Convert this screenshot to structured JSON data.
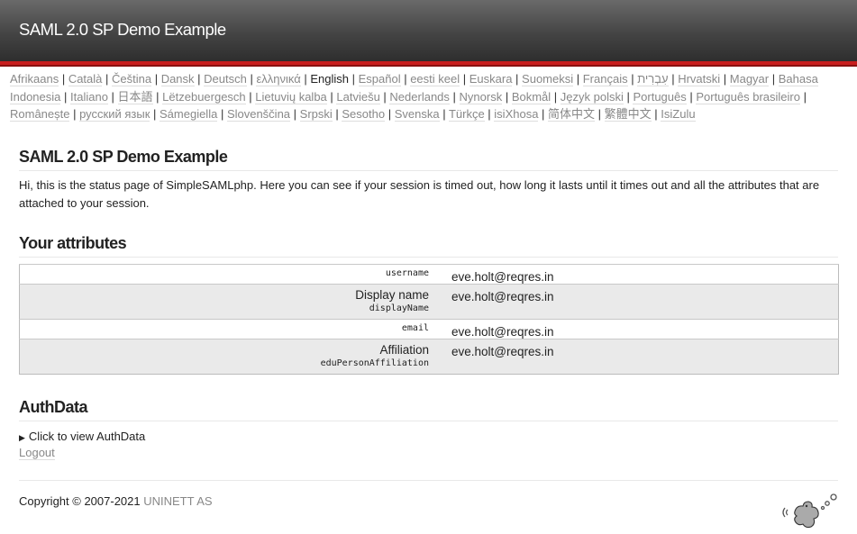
{
  "header": {
    "title": "SAML 2.0 SP Demo Example"
  },
  "languages": [
    {
      "label": "Afrikaans",
      "selected": false
    },
    {
      "label": "Català",
      "selected": false
    },
    {
      "label": "Čeština",
      "selected": false
    },
    {
      "label": "Dansk",
      "selected": false
    },
    {
      "label": "Deutsch",
      "selected": false
    },
    {
      "label": "ελληνικά",
      "selected": false
    },
    {
      "label": "English",
      "selected": true
    },
    {
      "label": "Español",
      "selected": false
    },
    {
      "label": "eesti keel",
      "selected": false
    },
    {
      "label": "Euskara",
      "selected": false
    },
    {
      "label": "Suomeksi",
      "selected": false
    },
    {
      "label": "Français",
      "selected": false
    },
    {
      "label": "עִבְרִית",
      "selected": false
    },
    {
      "label": "Hrvatski",
      "selected": false
    },
    {
      "label": "Magyar",
      "selected": false
    },
    {
      "label": "Bahasa Indonesia",
      "selected": false
    },
    {
      "label": "Italiano",
      "selected": false
    },
    {
      "label": "日本語",
      "selected": false
    },
    {
      "label": "Lëtzebuergesch",
      "selected": false
    },
    {
      "label": "Lietuvių kalba",
      "selected": false
    },
    {
      "label": "Latviešu",
      "selected": false
    },
    {
      "label": "Nederlands",
      "selected": false
    },
    {
      "label": "Nynorsk",
      "selected": false
    },
    {
      "label": "Bokmål",
      "selected": false
    },
    {
      "label": "Język polski",
      "selected": false
    },
    {
      "label": "Português",
      "selected": false
    },
    {
      "label": "Português brasileiro",
      "selected": false
    },
    {
      "label": "Românește",
      "selected": false
    },
    {
      "label": "русский язык",
      "selected": false
    },
    {
      "label": "Sámegiella",
      "selected": false
    },
    {
      "label": "Slovenščina",
      "selected": false
    },
    {
      "label": "Srpski",
      "selected": false
    },
    {
      "label": "Sesotho",
      "selected": false
    },
    {
      "label": "Svenska",
      "selected": false
    },
    {
      "label": "Türkçe",
      "selected": false
    },
    {
      "label": "isiXhosa",
      "selected": false
    },
    {
      "label": "简体中文",
      "selected": false
    },
    {
      "label": "繁體中文",
      "selected": false
    },
    {
      "label": "IsiZulu",
      "selected": false
    }
  ],
  "main": {
    "title": "SAML 2.0 SP Demo Example",
    "intro": "Hi, this is the status page of SimpleSAMLphp. Here you can see if your session is timed out, how long it lasts until it times out and all the attributes that are attached to your session.",
    "attributes_heading": "Your attributes",
    "attributes": [
      {
        "name": "",
        "id": "username",
        "value": "eve.holt@reqres.in"
      },
      {
        "name": "Display name",
        "id": "displayName",
        "value": "eve.holt@reqres.in"
      },
      {
        "name": "",
        "id": "email",
        "value": "eve.holt@reqres.in"
      },
      {
        "name": "Affiliation",
        "id": "eduPersonAffiliation",
        "value": "eve.holt@reqres.in"
      }
    ],
    "authdata_heading": "AuthData",
    "authdata_toggle": "Click to view AuthData",
    "logout_label": "Logout"
  },
  "footer": {
    "copyright": "Copyright © 2007-2021 ",
    "org": "UNINETT AS"
  },
  "colors": {
    "accent_bar": "#c81e1e",
    "link": "#888888"
  }
}
